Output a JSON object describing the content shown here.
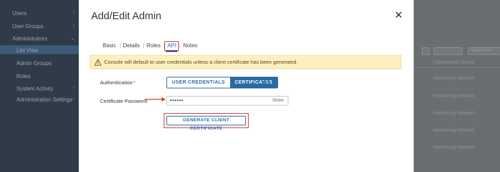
{
  "background": {
    "sidebar": {
      "items": [
        {
          "label": "Users"
        },
        {
          "label": "User Groups"
        },
        {
          "label": "Administrators"
        },
        {
          "label": "List View"
        },
        {
          "label": "Admin Groups"
        },
        {
          "label": "Roles"
        },
        {
          "label": "System Activity"
        },
        {
          "label": "Administration Settings"
        }
      ]
    },
    "table": {
      "header": "Organization Group",
      "rows": [
        "Hamkoring Network",
        "Hamkoring Network",
        "Hamkoring Network",
        "Hamkoring Network",
        "Hamkoring Network"
      ]
    },
    "search_placeholder": "Search List"
  },
  "modal": {
    "title": "Add/Edit Admin",
    "close_icon": "close-icon",
    "tabs": [
      {
        "label": "Basic",
        "active": false
      },
      {
        "label": "Details",
        "active": false
      },
      {
        "label": "Roles",
        "active": false
      },
      {
        "label": "API",
        "active": true
      },
      {
        "label": "Notes",
        "active": false
      }
    ],
    "alert": {
      "icon": "warning-icon",
      "text": "Console will default to user credentials unless a client certificate has been generated."
    },
    "authentication": {
      "label": "Authentication",
      "required_mark": "*",
      "options": [
        "USER CREDENTIALS",
        "CERTIFICATES"
      ],
      "selected": "CERTIFICATES",
      "info_icon": "info-icon"
    },
    "certificate_password": {
      "label": "Certificate Password",
      "value": "••••••",
      "show_label": "Show"
    },
    "generate_button": {
      "label": "GENERATE CLIENT CERTIFICATE"
    }
  },
  "colors": {
    "accent": "#2a6aa6",
    "highlight_red": "#d83a3a",
    "alert_bg": "#fbf0bf"
  }
}
